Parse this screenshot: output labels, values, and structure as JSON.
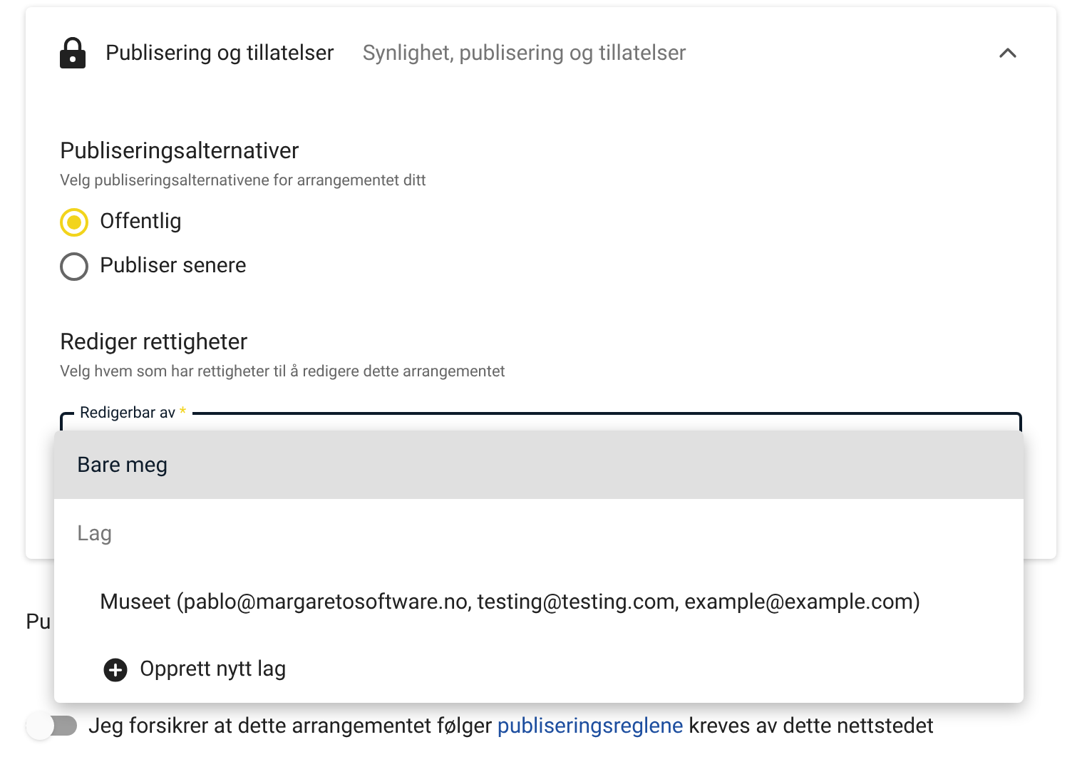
{
  "panel": {
    "title": "Publisering og tillatelser",
    "subtitle": "Synlighet, publisering og tillatelser",
    "expanded": true
  },
  "publishing": {
    "title": "Publiseringsalternativer",
    "description": "Velg publiseringsalternativene for arrangementet ditt",
    "options": [
      {
        "label": "Offentlig",
        "selected": true
      },
      {
        "label": "Publiser senere",
        "selected": false
      }
    ]
  },
  "permissions": {
    "title": "Rediger rettigheter",
    "description": "Velg hvem som har rettigheter til å redigere dette arrangementet",
    "field": {
      "label": "Redigerbar av",
      "required_mark": "*"
    }
  },
  "menu": {
    "items": [
      {
        "kind": "option",
        "label": "Bare meg",
        "selected": true
      },
      {
        "kind": "subheader",
        "label": "Lag"
      },
      {
        "kind": "option",
        "label": "Museet (pablo@margaretosoftware.no, testing@testing.com, example@example.com)",
        "selected": false
      },
      {
        "kind": "action",
        "label": "Opprett nytt lag"
      }
    ]
  },
  "below": {
    "heading": "Pu",
    "agreement": {
      "on": false,
      "text_before": "Jeg forsikrer at dette arrangementet følger",
      "link": "publiseringsreglene",
      "text_after": "kreves av dette nettstedet"
    }
  }
}
